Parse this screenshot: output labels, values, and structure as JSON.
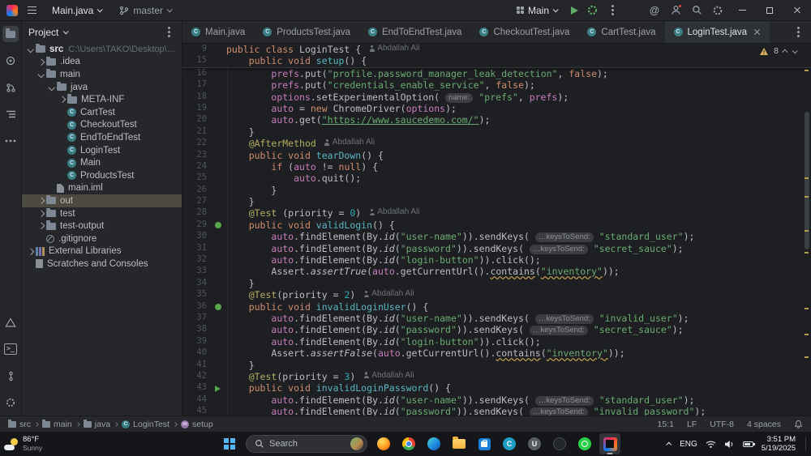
{
  "colors": {
    "accent": "#3574f0",
    "editor_bg": "#1e1f22",
    "chrome_bg": "#232528",
    "green": "#5fad65",
    "warning": "#d6b25e",
    "tree_selection": "#4c4a3e"
  },
  "icons": {
    "class_letter": "C",
    "method_letter": "m"
  },
  "titlebar": {
    "project_widget": "Main.java",
    "branch": "master",
    "run_config": "Main"
  },
  "tabs": [
    {
      "label": "Main.java"
    },
    {
      "label": "ProductsTest.java"
    },
    {
      "label": "EndToEndTest.java"
    },
    {
      "label": "CheckoutTest.java"
    },
    {
      "label": "CartTest.java"
    },
    {
      "label": "LoginTest.java",
      "active": true
    }
  ],
  "project": {
    "header": "Project",
    "tree": [
      {
        "label": "src",
        "path": "C:\\Users\\TAKO\\Desktop\\Project\\Pro",
        "ind": 0,
        "icon": "folder",
        "exp": "down",
        "bold": true
      },
      {
        "label": ".idea",
        "ind": 1,
        "icon": "folder",
        "exp": "right"
      },
      {
        "label": "main",
        "ind": 1,
        "icon": "folder",
        "exp": "down"
      },
      {
        "label": "java",
        "ind": 2,
        "icon": "folder",
        "exp": "down"
      },
      {
        "label": "META-INF",
        "ind": 3,
        "icon": "folder",
        "exp": "right"
      },
      {
        "label": "CartTest",
        "ind": 3,
        "icon": "class"
      },
      {
        "label": "CheckoutTest",
        "ind": 3,
        "icon": "class"
      },
      {
        "label": "EndToEndTest",
        "ind": 3,
        "icon": "class"
      },
      {
        "label": "LoginTest",
        "ind": 3,
        "icon": "class"
      },
      {
        "label": "Main",
        "ind": 3,
        "icon": "class"
      },
      {
        "label": "ProductsTest",
        "ind": 3,
        "icon": "class"
      },
      {
        "label": "main.iml",
        "ind": 2,
        "icon": "file"
      },
      {
        "label": "out",
        "ind": 1,
        "icon": "folder",
        "exp": "right",
        "selected": true
      },
      {
        "label": "test",
        "ind": 1,
        "icon": "folder",
        "exp": "right"
      },
      {
        "label": "test-output",
        "ind": 1,
        "icon": "folder",
        "exp": "right"
      },
      {
        "label": ".gitignore",
        "ind": 1,
        "icon": "ignore"
      },
      {
        "label": "External Libraries",
        "ind": 0,
        "icon": "lib",
        "exp": "right"
      },
      {
        "label": "Scratches and Consoles",
        "ind": 0,
        "icon": "scratch"
      }
    ]
  },
  "editor": {
    "inspections": {
      "warnings": "8"
    },
    "sticky": [
      {
        "n": "9",
        "seg": [
          [
            "k",
            "public class "
          ],
          [
            "d",
            "LoginTest {"
          ]
        ],
        "author": "Abdallah Ali"
      },
      {
        "n": "15",
        "seg": [
          [
            "d",
            "    "
          ],
          [
            "k",
            "public void "
          ],
          [
            "m",
            "setup"
          ],
          [
            "d",
            "() {"
          ]
        ]
      }
    ],
    "lines": [
      {
        "n": "16",
        "seg": [
          [
            "d",
            "        "
          ],
          [
            "f",
            "prefs"
          ],
          [
            "d",
            ".put("
          ],
          [
            "s",
            "\"profile.password_manager_leak_detection\""
          ],
          [
            "d",
            ", "
          ],
          [
            "k",
            "false"
          ],
          [
            "d",
            ");"
          ]
        ]
      },
      {
        "n": "17",
        "seg": [
          [
            "d",
            "        "
          ],
          [
            "f",
            "prefs"
          ],
          [
            "d",
            ".put("
          ],
          [
            "s",
            "\"credentials_enable_service\""
          ],
          [
            "d",
            ", "
          ],
          [
            "k",
            "false"
          ],
          [
            "d",
            ");"
          ]
        ]
      },
      {
        "n": "18",
        "seg": [
          [
            "d",
            "        "
          ],
          [
            "f",
            "options"
          ],
          [
            "d",
            ".setExperimentalOption( "
          ],
          [
            "h",
            "name:"
          ],
          [
            "d",
            " "
          ],
          [
            "s",
            "\"prefs\""
          ],
          [
            "d",
            ", "
          ],
          [
            "f",
            "prefs"
          ],
          [
            "d",
            ");"
          ]
        ]
      },
      {
        "n": "19",
        "seg": [
          [
            "d",
            "        "
          ],
          [
            "f",
            "auto"
          ],
          [
            "d",
            " = "
          ],
          [
            "k",
            "new "
          ],
          [
            "d",
            "ChromeDriver("
          ],
          [
            "f",
            "options"
          ],
          [
            "d",
            ");"
          ]
        ]
      },
      {
        "n": "20",
        "seg": [
          [
            "d",
            "        "
          ],
          [
            "f",
            "auto"
          ],
          [
            "d",
            ".get("
          ],
          [
            "su",
            "\"https://www.saucedemo.com/\""
          ],
          [
            "d",
            ");"
          ]
        ]
      },
      {
        "n": "21",
        "seg": [
          [
            "d",
            "    }"
          ]
        ]
      },
      {
        "n": "22",
        "seg": [
          [
            "d",
            "    "
          ],
          [
            "a",
            "@AfterMethod"
          ]
        ],
        "author": "Abdallah Ali"
      },
      {
        "n": "23",
        "seg": [
          [
            "d",
            "    "
          ],
          [
            "k",
            "public void "
          ],
          [
            "m",
            "tearDown"
          ],
          [
            "d",
            "() {"
          ]
        ]
      },
      {
        "n": "24",
        "seg": [
          [
            "d",
            "        "
          ],
          [
            "k",
            "if"
          ],
          [
            "d",
            " ("
          ],
          [
            "f",
            "auto"
          ],
          [
            "d",
            " != "
          ],
          [
            "k",
            "null"
          ],
          [
            "d",
            ") {"
          ]
        ]
      },
      {
        "n": "25",
        "seg": [
          [
            "d",
            "            "
          ],
          [
            "f",
            "auto"
          ],
          [
            "d",
            ".quit();"
          ]
        ]
      },
      {
        "n": "26",
        "seg": [
          [
            "d",
            "        }"
          ]
        ]
      },
      {
        "n": "27",
        "seg": [
          [
            "d",
            "    }"
          ]
        ]
      },
      {
        "n": "28",
        "seg": [
          [
            "d",
            "    "
          ],
          [
            "a",
            "@Test"
          ],
          [
            "d",
            " (priority = "
          ],
          [
            "n2",
            "0"
          ],
          [
            "d",
            ")"
          ]
        ],
        "author": "Abdallah Ali"
      },
      {
        "n": "29",
        "gut": "run",
        "seg": [
          [
            "d",
            "    "
          ],
          [
            "k",
            "public void "
          ],
          [
            "m",
            "validLogin"
          ],
          [
            "d",
            "() {"
          ]
        ]
      },
      {
        "n": "30",
        "seg": [
          [
            "d",
            "        "
          ],
          [
            "f",
            "auto"
          ],
          [
            "d",
            ".findElement(By."
          ],
          [
            "st",
            "id"
          ],
          [
            "d",
            "("
          ],
          [
            "s",
            "\"user-name\""
          ],
          [
            "d",
            ")).sendKeys( "
          ],
          [
            "h",
            "…keysToSend:"
          ],
          [
            "d",
            " "
          ],
          [
            "s",
            "\"standard_user\""
          ],
          [
            "d",
            ");"
          ]
        ]
      },
      {
        "n": "31",
        "seg": [
          [
            "d",
            "        "
          ],
          [
            "f",
            "auto"
          ],
          [
            "d",
            ".findElement(By."
          ],
          [
            "st",
            "id"
          ],
          [
            "d",
            "("
          ],
          [
            "s",
            "\"password\""
          ],
          [
            "d",
            ")).sendKeys( "
          ],
          [
            "h",
            "…keysToSend:"
          ],
          [
            "d",
            " "
          ],
          [
            "s",
            "\"secret_sauce\""
          ],
          [
            "d",
            ");"
          ]
        ]
      },
      {
        "n": "32",
        "seg": [
          [
            "d",
            "        "
          ],
          [
            "f",
            "auto"
          ],
          [
            "d",
            ".findElement(By."
          ],
          [
            "st",
            "id"
          ],
          [
            "d",
            "("
          ],
          [
            "s",
            "\"login-button\""
          ],
          [
            "d",
            ")).click();"
          ]
        ]
      },
      {
        "n": "33",
        "seg": [
          [
            "d",
            "        Assert."
          ],
          [
            "st",
            "assertTrue"
          ],
          [
            "d",
            "("
          ],
          [
            "f",
            "auto"
          ],
          [
            "d",
            ".getCurrentUrl()."
          ],
          [
            "wu",
            "contains"
          ],
          [
            "d",
            "("
          ],
          [
            "swu",
            "\"inventory\""
          ],
          [
            "d",
            "));"
          ]
        ]
      },
      {
        "n": "34",
        "seg": [
          [
            "d",
            "    }"
          ]
        ]
      },
      {
        "n": "35",
        "seg": [
          [
            "d",
            "    "
          ],
          [
            "a",
            "@Test"
          ],
          [
            "d",
            "(priority = "
          ],
          [
            "n2",
            "2"
          ],
          [
            "d",
            ")"
          ]
        ],
        "author": "Abdallah Ali"
      },
      {
        "n": "36",
        "gut": "run",
        "seg": [
          [
            "d",
            "    "
          ],
          [
            "k",
            "public void "
          ],
          [
            "m",
            "invalidLoginUser"
          ],
          [
            "d",
            "() {"
          ]
        ]
      },
      {
        "n": "37",
        "seg": [
          [
            "d",
            "        "
          ],
          [
            "f",
            "auto"
          ],
          [
            "d",
            ".findElement(By."
          ],
          [
            "st",
            "id"
          ],
          [
            "d",
            "("
          ],
          [
            "s",
            "\"user-name\""
          ],
          [
            "d",
            ")).sendKeys( "
          ],
          [
            "h",
            "…keysToSend:"
          ],
          [
            "d",
            " "
          ],
          [
            "s",
            "\"invalid_user\""
          ],
          [
            "d",
            ");"
          ]
        ]
      },
      {
        "n": "38",
        "seg": [
          [
            "d",
            "        "
          ],
          [
            "f",
            "auto"
          ],
          [
            "d",
            ".findElement(By."
          ],
          [
            "st",
            "id"
          ],
          [
            "d",
            "("
          ],
          [
            "s",
            "\"password\""
          ],
          [
            "d",
            ")).sendKeys( "
          ],
          [
            "h",
            "…keysToSend:"
          ],
          [
            "d",
            " "
          ],
          [
            "s",
            "\"secret_sauce\""
          ],
          [
            "d",
            ");"
          ]
        ]
      },
      {
        "n": "39",
        "seg": [
          [
            "d",
            "        "
          ],
          [
            "f",
            "auto"
          ],
          [
            "d",
            ".findElement(By."
          ],
          [
            "st",
            "id"
          ],
          [
            "d",
            "("
          ],
          [
            "s",
            "\"login-button\""
          ],
          [
            "d",
            ")).click();"
          ]
        ]
      },
      {
        "n": "40",
        "seg": [
          [
            "d",
            "        Assert."
          ],
          [
            "st",
            "assertFalse"
          ],
          [
            "d",
            "("
          ],
          [
            "f",
            "auto"
          ],
          [
            "d",
            ".getCurrentUrl()."
          ],
          [
            "wu",
            "contains"
          ],
          [
            "d",
            "("
          ],
          [
            "swu",
            "\"inventory\""
          ],
          [
            "d",
            "));"
          ]
        ]
      },
      {
        "n": "41",
        "seg": [
          [
            "d",
            "    }"
          ]
        ]
      },
      {
        "n": "42",
        "seg": [
          [
            "d",
            "    "
          ],
          [
            "a",
            "@Test"
          ],
          [
            "d",
            "(priority = "
          ],
          [
            "n2",
            "3"
          ],
          [
            "d",
            ")"
          ]
        ],
        "author": "Abdallah Ali"
      },
      {
        "n": "43",
        "gut": "play",
        "seg": [
          [
            "d",
            "    "
          ],
          [
            "k",
            "public void "
          ],
          [
            "m",
            "invalidLoginPassword"
          ],
          [
            "d",
            "() {"
          ]
        ]
      },
      {
        "n": "44",
        "seg": [
          [
            "d",
            "        "
          ],
          [
            "f",
            "auto"
          ],
          [
            "d",
            ".findElement(By."
          ],
          [
            "st",
            "id"
          ],
          [
            "d",
            "("
          ],
          [
            "s",
            "\"user-name\""
          ],
          [
            "d",
            ")).sendKeys( "
          ],
          [
            "h",
            "…keysToSend:"
          ],
          [
            "d",
            " "
          ],
          [
            "s",
            "\"standard_user\""
          ],
          [
            "d",
            ");"
          ]
        ]
      },
      {
        "n": "45",
        "seg": [
          [
            "d",
            "        "
          ],
          [
            "f",
            "auto"
          ],
          [
            "d",
            ".findElement(By."
          ],
          [
            "st",
            "id"
          ],
          [
            "d",
            "("
          ],
          [
            "s",
            "\"password\""
          ],
          [
            "d",
            ")).sendKeys( "
          ],
          [
            "h",
            "…keysToSend:"
          ],
          [
            "d",
            " "
          ],
          [
            "s",
            "\"invalid_password\""
          ],
          [
            "d",
            ");"
          ]
        ]
      }
    ]
  },
  "statusbar": {
    "breadcrumbs": [
      {
        "label": "src",
        "icon": "folder"
      },
      {
        "label": "main",
        "icon": "folder"
      },
      {
        "label": "java",
        "icon": "folder"
      },
      {
        "label": "LoginTest",
        "icon": "class"
      },
      {
        "label": "setup",
        "icon": "method"
      }
    ],
    "caret": "15:1",
    "line_ending": "LF",
    "encoding": "UTF-8",
    "indent": "4 spaces"
  },
  "taskbar": {
    "weather_temp": "86°F",
    "weather_cond": "Sunny",
    "search_placeholder": "Search",
    "apps": [
      {
        "name": "firefox"
      },
      {
        "name": "chrome"
      },
      {
        "name": "edge"
      },
      {
        "name": "folder"
      },
      {
        "name": "store"
      },
      {
        "name": "c-app",
        "letter": "C"
      },
      {
        "name": "u-app",
        "letter": "U"
      },
      {
        "name": "dark-app"
      },
      {
        "name": "whatsapp"
      },
      {
        "name": "intellij",
        "active": true
      }
    ],
    "language": "ENG",
    "time": "3:51 PM",
    "date": "5/19/2025"
  }
}
